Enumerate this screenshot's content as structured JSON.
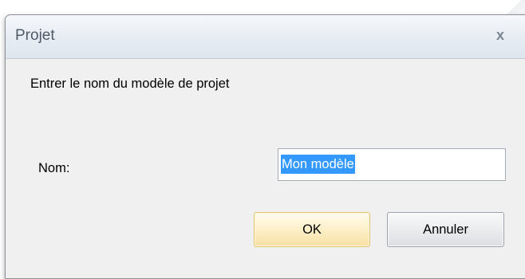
{
  "dialog": {
    "title": "Projet",
    "close_label": "x",
    "prompt": "Entrer le nom du modèle de projet",
    "name_label": "Nom:",
    "name_value": "Mon modèle",
    "ok_label": "OK",
    "cancel_label": "Annuler"
  },
  "colors": {
    "selection": "#3399ff",
    "ok_border": "#e3c46e"
  }
}
